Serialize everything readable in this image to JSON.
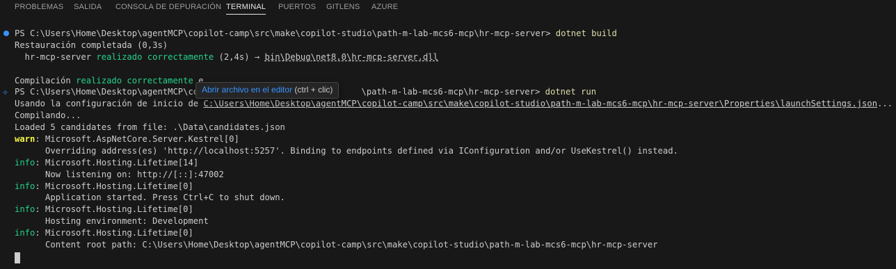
{
  "tabs": [
    {
      "label": "PROBLEMAS"
    },
    {
      "label": "SALIDA"
    },
    {
      "label": "CONSOLA DE DEPURACIÓN"
    },
    {
      "label": "TERMINAL"
    },
    {
      "label": "PUERTOS"
    },
    {
      "label": "GITLENS"
    },
    {
      "label": "AZURE"
    }
  ],
  "active_tab": "TERMINAL",
  "terminal": {
    "prompt1": "PS C:\\Users\\Home\\Desktop\\agentMCP\\copilot-camp\\src\\make\\copilot-studio\\path-m-lab-mcs6-mcp\\hr-mcp-server> ",
    "cmd1": "dotnet build",
    "restore": "Restauración completada (0,3s)",
    "build_project": "  hr-mcp-server ",
    "build_ok": "realizado correctamente",
    "build_time": " (2,4s) → ",
    "build_dll": "bin\\Debug\\net8.0\\hr-mcp-server.dll",
    "compile_prefix": "Compilación ",
    "compile_ok": "realizado correctamente",
    "compile_suffix": " e",
    "prompt2_a": "PS C:\\Users\\Home\\Desktop\\agentMCP\\cop",
    "prompt2_b": "\\path-m-lab-mcs6-mcp\\hr-mcp-server> ",
    "cmd2": "dotnet run",
    "using_prefix": "Usando la configuración de inicio de ",
    "using_path": "C:\\Users\\Home\\Desktop\\agentMCP\\copilot-camp\\src\\make\\copilot-studio\\path-m-lab-mcs6-mcp\\hr-mcp-server\\Properties\\launchSettings.json",
    "using_ellipsis": "...",
    "compiling": "Compilando...",
    "loaded": "Loaded 5 candidates from file: .\\Data\\candidates.json",
    "warn_tag": "warn",
    "warn_src": ": Microsoft.AspNetCore.Server.Kestrel[0]",
    "warn_msg": "      Overriding address(es) 'http://localhost:5257'. Binding to endpoints defined via IConfiguration and/or UseKestrel() instead.",
    "info_tag": "info",
    "info1_src": ": Microsoft.Hosting.Lifetime[14]",
    "info1_msg": "      Now listening on: http://[::]:47002",
    "info2_src": ": Microsoft.Hosting.Lifetime[0]",
    "info2_msg": "      Application started. Press Ctrl+C to shut down.",
    "info3_src": ": Microsoft.Hosting.Lifetime[0]",
    "info3_msg": "      Hosting environment: Development",
    "info4_src": ": Microsoft.Hosting.Lifetime[0]",
    "info4_msg": "      Content root path: C:\\Users\\Home\\Desktop\\agentMCP\\copilot-camp\\src\\make\\copilot-studio\\path-m-lab-mcs6-mcp\\hr-mcp-server"
  },
  "tooltip": {
    "link_text": "Abrir archivo en el editor",
    "shortcut": " (ctrl + clic)"
  },
  "colors": {
    "background": "#181818",
    "text": "#cccccc",
    "command": "#dcdcaa",
    "success": "#23d18b",
    "warn": "#f5f543",
    "accent": "#3794ff"
  },
  "icons": {
    "prompt_marker": "circle-dot-icon",
    "sparkle_marker": "sparkle-icon"
  }
}
